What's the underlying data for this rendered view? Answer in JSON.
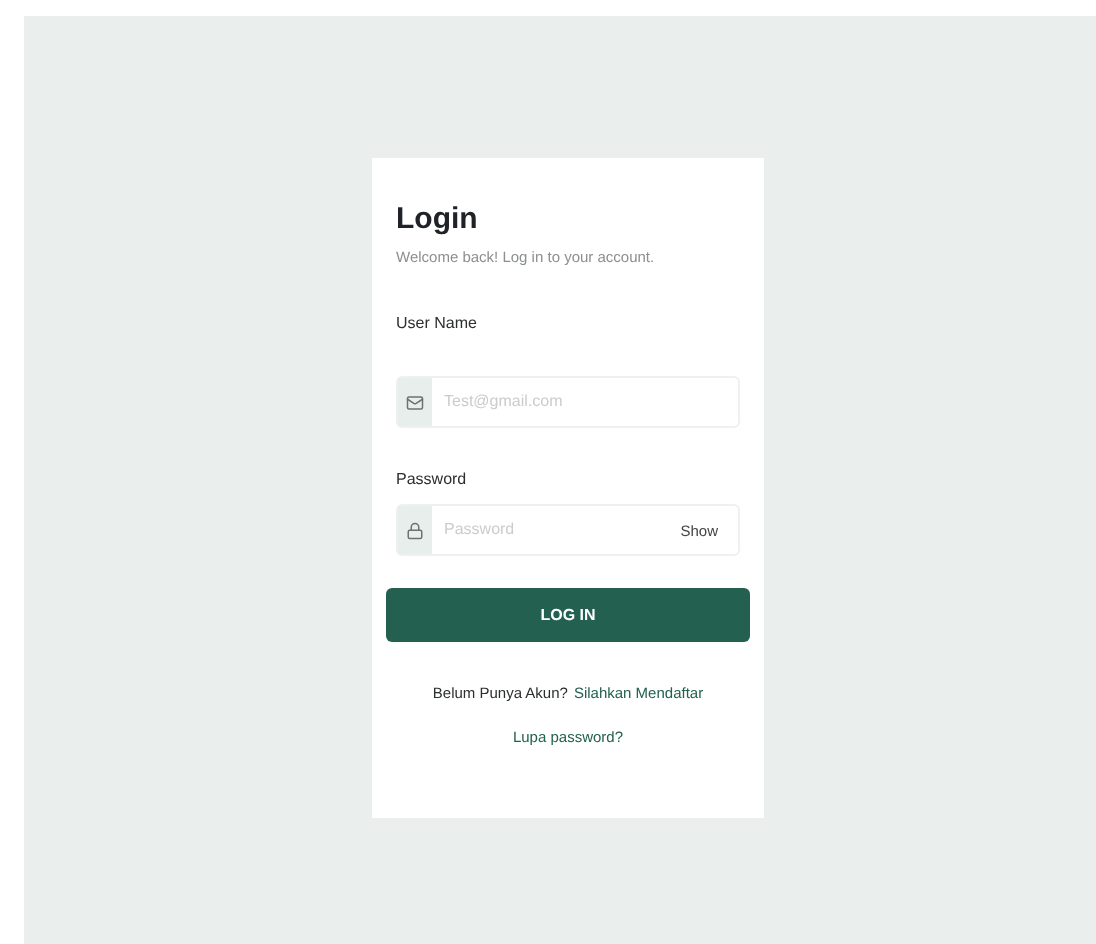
{
  "login": {
    "title": "Login",
    "subtitle": "Welcome back! Log in to your account.",
    "fields": [
      {
        "kind": "email",
        "label": "User Name",
        "placeholder": "Test@gmail.com"
      },
      {
        "kind": "password",
        "label": "Password",
        "placeholder": "Password",
        "toggle": "Show"
      }
    ],
    "submit": "LOG IN",
    "register_prompt": "Belum Punya Akun?",
    "register_link": "Silahkan Mendaftar",
    "forgot_link": "Lupa password?"
  }
}
